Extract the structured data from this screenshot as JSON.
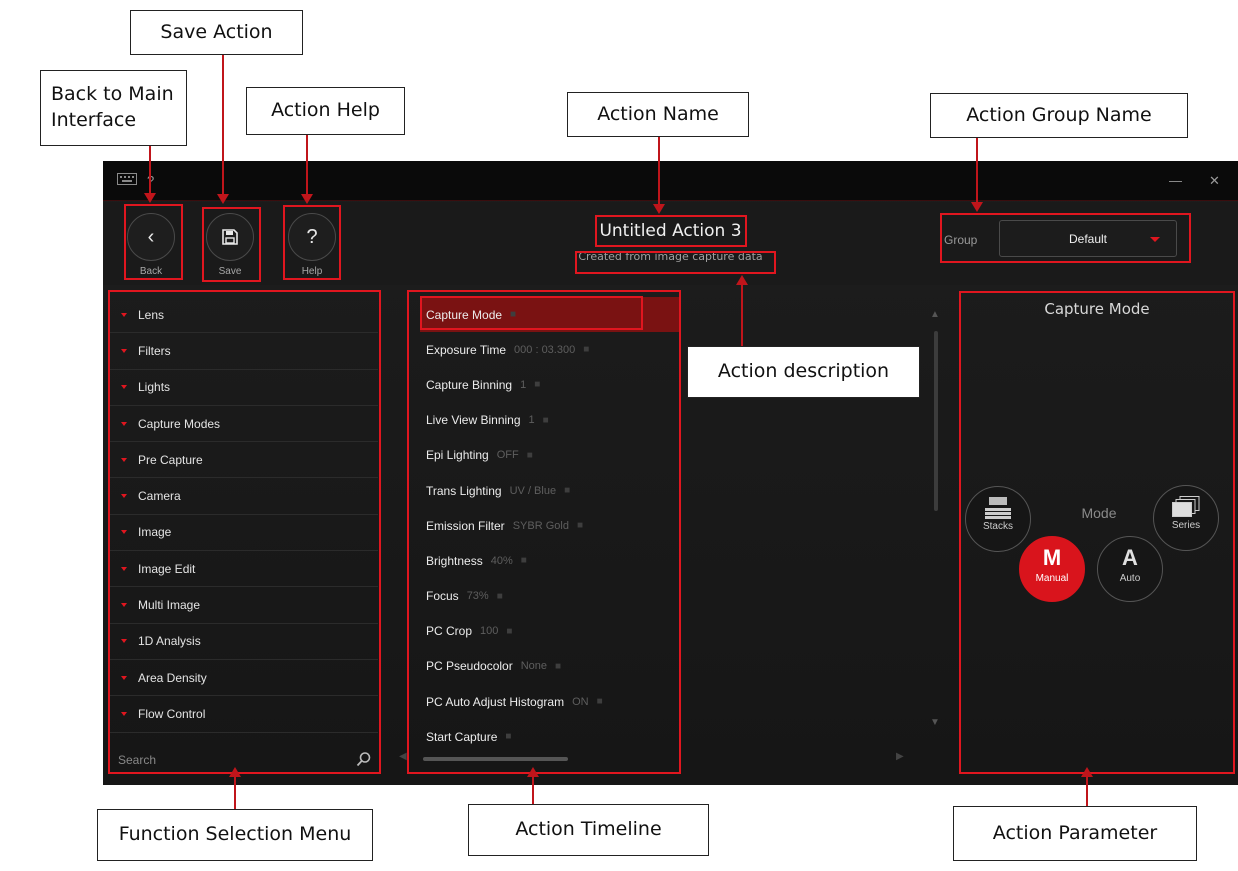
{
  "callouts": {
    "save_action": "Save Action",
    "back_to_main": "Back to Main Interface",
    "action_help": "Action Help",
    "action_name": "Action Name",
    "action_group_name": "Action Group Name",
    "action_description": "Action description",
    "function_selection_menu": "Function Selection Menu",
    "action_timeline": "Action Timeline",
    "action_parameter": "Action Parameter"
  },
  "titlebar": {
    "help_glyph": "?",
    "minimize_glyph": "—",
    "close_glyph": "✕"
  },
  "header": {
    "back": {
      "icon": "chevron-left-icon",
      "glyph": "‹",
      "label": "Back"
    },
    "save": {
      "icon": "floppy-disk-icon",
      "label": "Save"
    },
    "help": {
      "icon": "question-icon",
      "glyph": "?",
      "label": "Help"
    },
    "action_name": "Untitled Action 3",
    "action_description": "Created from image capture data",
    "group_label": "Group",
    "group_value": "Default"
  },
  "menu": {
    "items": [
      "Lens",
      "Filters",
      "Lights",
      "Capture Modes",
      "Pre Capture",
      "Camera",
      "Image",
      "Image Edit",
      "Multi Image",
      "1D Analysis",
      "Area Density",
      "Flow Control"
    ],
    "search_placeholder": "Search"
  },
  "timeline": {
    "items": [
      {
        "name": "Capture Mode",
        "value": ""
      },
      {
        "name": "Exposure Time",
        "value": "000 : 03.300"
      },
      {
        "name": "Capture Binning",
        "value": "1"
      },
      {
        "name": "Live View Binning",
        "value": "1"
      },
      {
        "name": "Epi Lighting",
        "value": "OFF"
      },
      {
        "name": "Trans Lighting",
        "value": "UV / Blue"
      },
      {
        "name": "Emission Filter",
        "value": "SYBR Gold"
      },
      {
        "name": "Brightness",
        "value": "40%"
      },
      {
        "name": "Focus",
        "value": "73%"
      },
      {
        "name": "PC Crop",
        "value": "100"
      },
      {
        "name": "PC Pseudocolor",
        "value": "None"
      },
      {
        "name": "PC Auto Adjust Histogram",
        "value": "ON"
      },
      {
        "name": "Start Capture",
        "value": ""
      }
    ],
    "selected_index": 0
  },
  "parameter": {
    "title": "Capture Mode",
    "mode_label": "Mode",
    "stacks_label": "Stacks",
    "series_label": "Series",
    "manual_glyph": "M",
    "manual_label": "Manual",
    "auto_glyph": "A",
    "auto_label": "Auto",
    "selected": "Manual"
  },
  "colors": {
    "accent": "#e0161f",
    "background": "#1a1a1a"
  }
}
